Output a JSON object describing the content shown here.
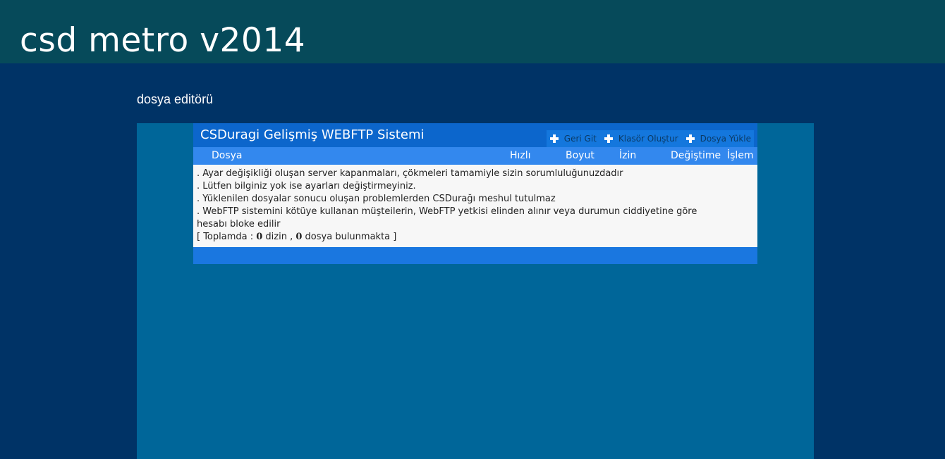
{
  "header": {
    "site_title": "csd metro v2014"
  },
  "page": {
    "section_title": "dosya editörü"
  },
  "panel": {
    "title": "CSDuragi Gelişmiş WEBFTP Sistemi",
    "toolbar": {
      "back_label": "Geri Git",
      "create_folder_label": "Klasör Oluştur",
      "upload_label": "Dosya Yükle"
    },
    "columns": {
      "file": "Dosya",
      "speed": "Hızlı",
      "size": "Boyut",
      "permission": "İzin",
      "modified": "Değiştime",
      "action": "İşlem"
    },
    "notices": [
      ". Ayar değişikliği oluşan server kapanmaları, çökmeleri tamamiyle sizin sorumluluğunuzdadır",
      ". Lütfen bilginiz yok ise ayarları değiştirmeyiniz.",
      ". Yüklenilen dosyalar sonucu oluşan problemlerden CSDurağı meshul tutulmaz",
      ". WebFTP sistemini kötüye kullanan müşteilerin, WebFTP yetkisi elinden alınır veya durumun ciddiyetine göre",
      "hesabı bloke edilir"
    ],
    "summary": {
      "prefix": "[ Toplamda : ",
      "dir_count": "0",
      "dir_label": " dizin , ",
      "file_count": "0",
      "file_label": " dosya bulunmakta ]"
    }
  }
}
